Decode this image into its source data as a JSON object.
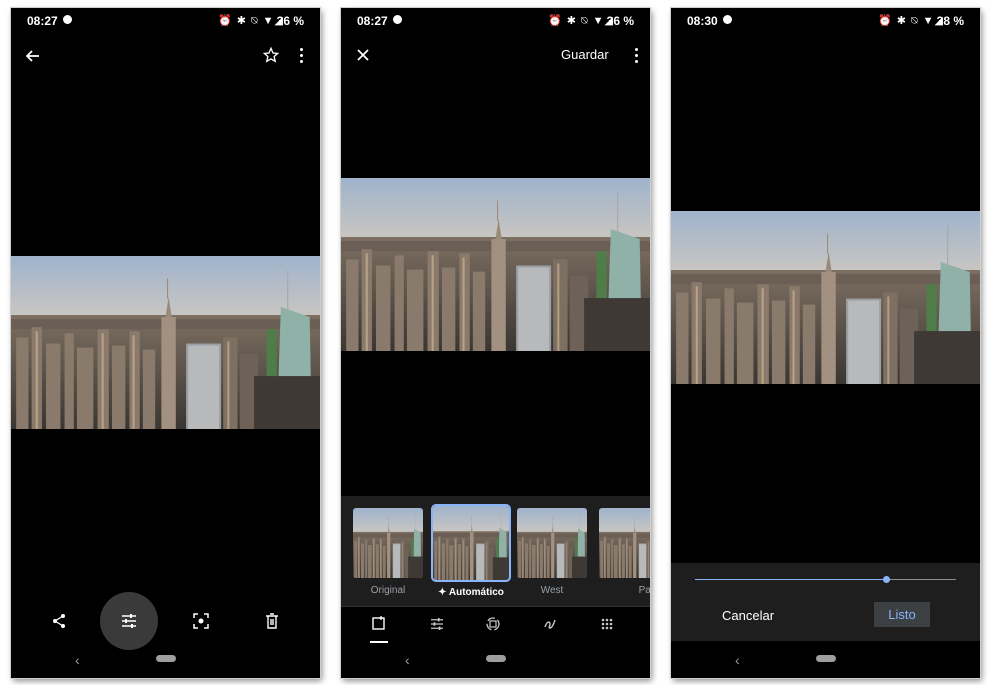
{
  "screens": [
    {
      "status": {
        "time": "08:27",
        "icons": "⏰ ✱ ⍉ ▼◢",
        "battery": "36 %"
      },
      "toolbar": {
        "back_icon": "arrow-left-icon",
        "star_icon": "star-outline-icon",
        "more_icon": "more-vert-icon"
      },
      "bottom_actions": [
        "share-icon",
        "edit-sliders-icon",
        "lens-icon",
        "trash-icon"
      ]
    },
    {
      "status": {
        "time": "08:27",
        "icons": "⏰ ✱ ⍉ ▼◢",
        "battery": "36 %"
      },
      "toolbar": {
        "close_icon": "close-icon",
        "save_label": "Guardar",
        "more_icon": "more-vert-icon"
      },
      "filters": [
        {
          "label": "Original",
          "selected": false
        },
        {
          "label": "Automático",
          "selected": true
        },
        {
          "label": "West",
          "selected": false
        },
        {
          "label": "Palma",
          "selected": false
        }
      ],
      "tools": [
        "suggestions-icon",
        "adjust-icon",
        "crop-rotate-icon",
        "markup-icon",
        "more-tools-icon"
      ]
    },
    {
      "status": {
        "time": "08:30",
        "icons": "⏰ ✱ ⍉ ▼◢",
        "battery": "38 %"
      },
      "slider": {
        "value_fraction": 0.73
      },
      "cancel_label": "Cancelar",
      "done_label": "Listo"
    }
  ],
  "colors": {
    "accent": "#8ab4f8",
    "background": "#000000",
    "panel": "#1e1e1e"
  }
}
